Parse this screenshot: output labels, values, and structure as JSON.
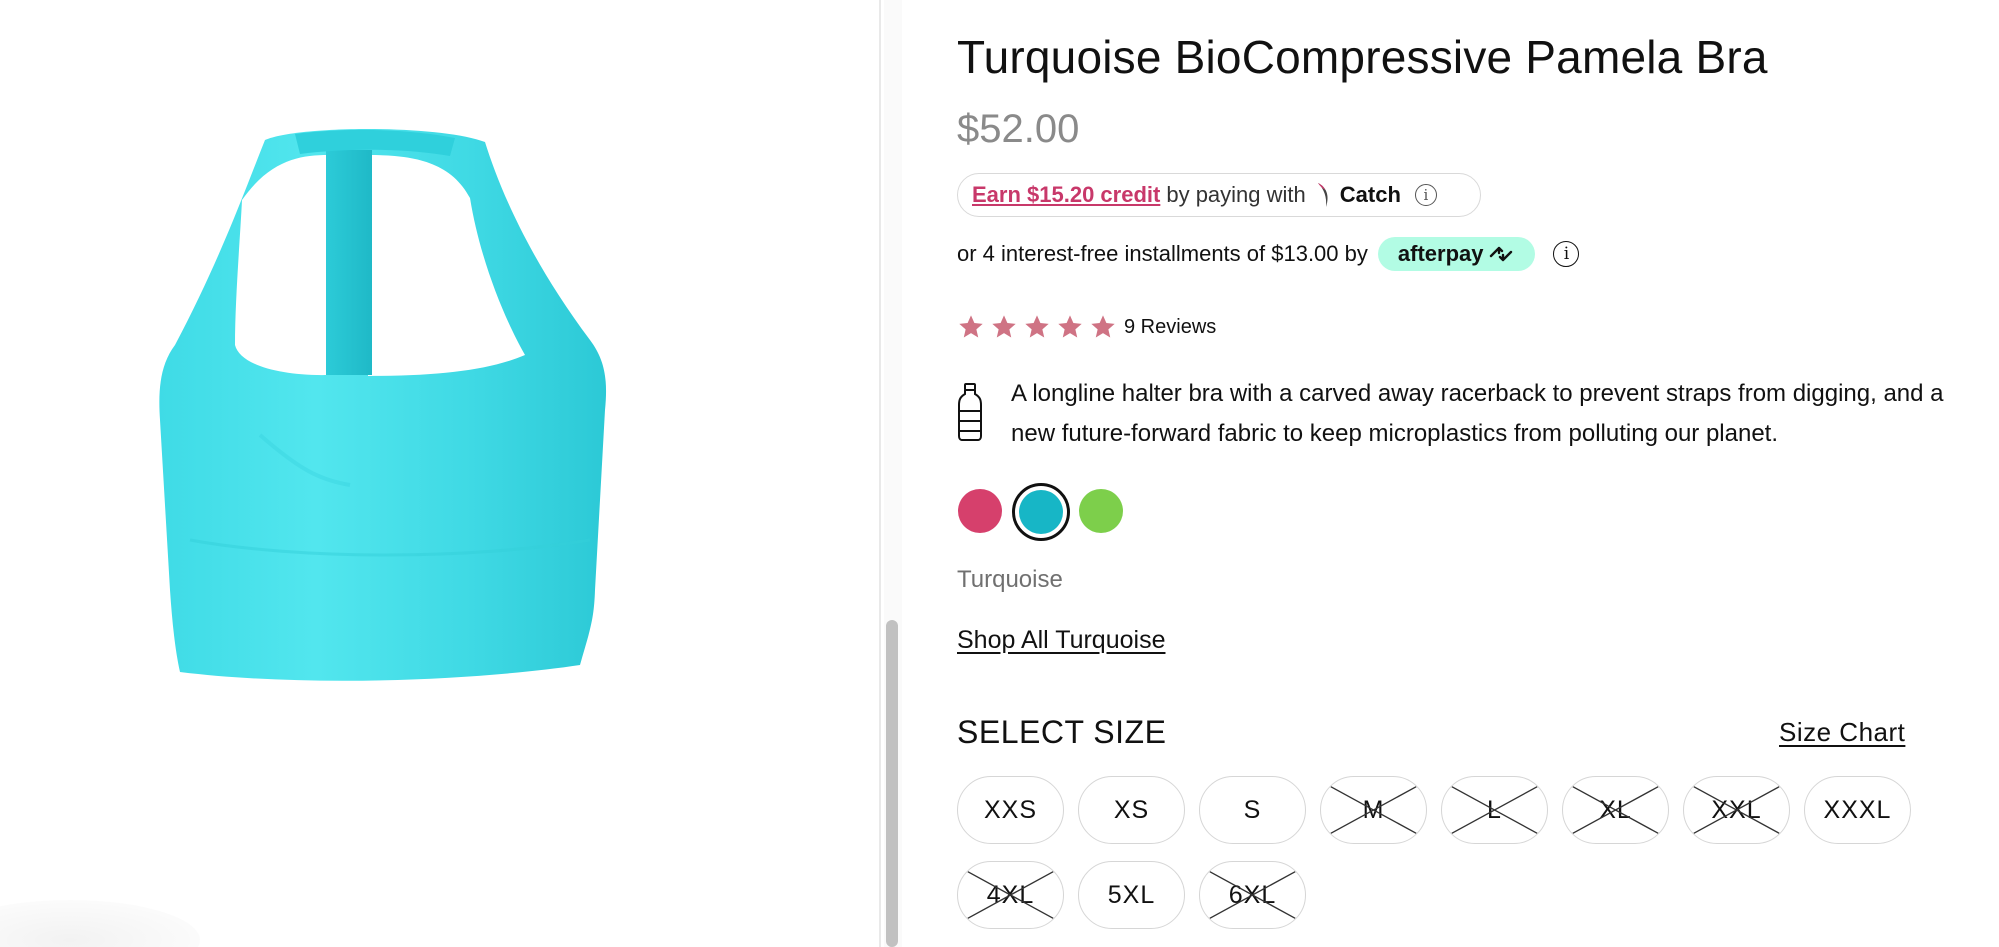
{
  "product": {
    "title": "Turquoise BioCompressive Pamela Bra",
    "price": "$52.00",
    "image_alt": "Turquoise halter bra product image",
    "image_color": "#4fe3ec"
  },
  "catch": {
    "credit_link": "Earn $15.20 credit",
    "middle_text": "by paying with",
    "brand": "Catch",
    "info_glyph": "i",
    "icon": "catch-logo-icon",
    "accent": "#c8386a"
  },
  "afterpay": {
    "text": "or 4 interest-free installments of $13.00 by",
    "badge": "afterpay",
    "info_glyph": "i",
    "badge_color": "#b2fce4"
  },
  "rating": {
    "stars": 5,
    "max_stars": 5,
    "reviews_label": "9 Reviews",
    "star_color": "#cf7384"
  },
  "description": {
    "icon": "water-bottle-icon",
    "text": "A longline halter bra with a carved away racerback to prevent straps from digging, and a new future-forward fabric to keep microplastics from polluting our planet."
  },
  "colors": {
    "options": [
      {
        "name": "pink",
        "hex": "#d6406c"
      },
      {
        "name": "turquoise",
        "hex": "#17b6c6",
        "selected": true
      },
      {
        "name": "green",
        "hex": "#7dcf4b"
      }
    ],
    "selected_label": "Turquoise",
    "shop_all_link": "Shop All Turquoise"
  },
  "sizes": {
    "heading": "SELECT SIZE",
    "chart_link": "Size Chart",
    "options": [
      {
        "label": "XXS",
        "available": true
      },
      {
        "label": "XS",
        "available": true
      },
      {
        "label": "S",
        "available": true
      },
      {
        "label": "M",
        "available": false
      },
      {
        "label": "L",
        "available": false
      },
      {
        "label": "XL",
        "available": false
      },
      {
        "label": "XXL",
        "available": false
      },
      {
        "label": "XXXL",
        "available": true
      },
      {
        "label": "4XL",
        "available": false
      },
      {
        "label": "5XL",
        "available": true
      },
      {
        "label": "6XL",
        "available": false
      }
    ]
  }
}
